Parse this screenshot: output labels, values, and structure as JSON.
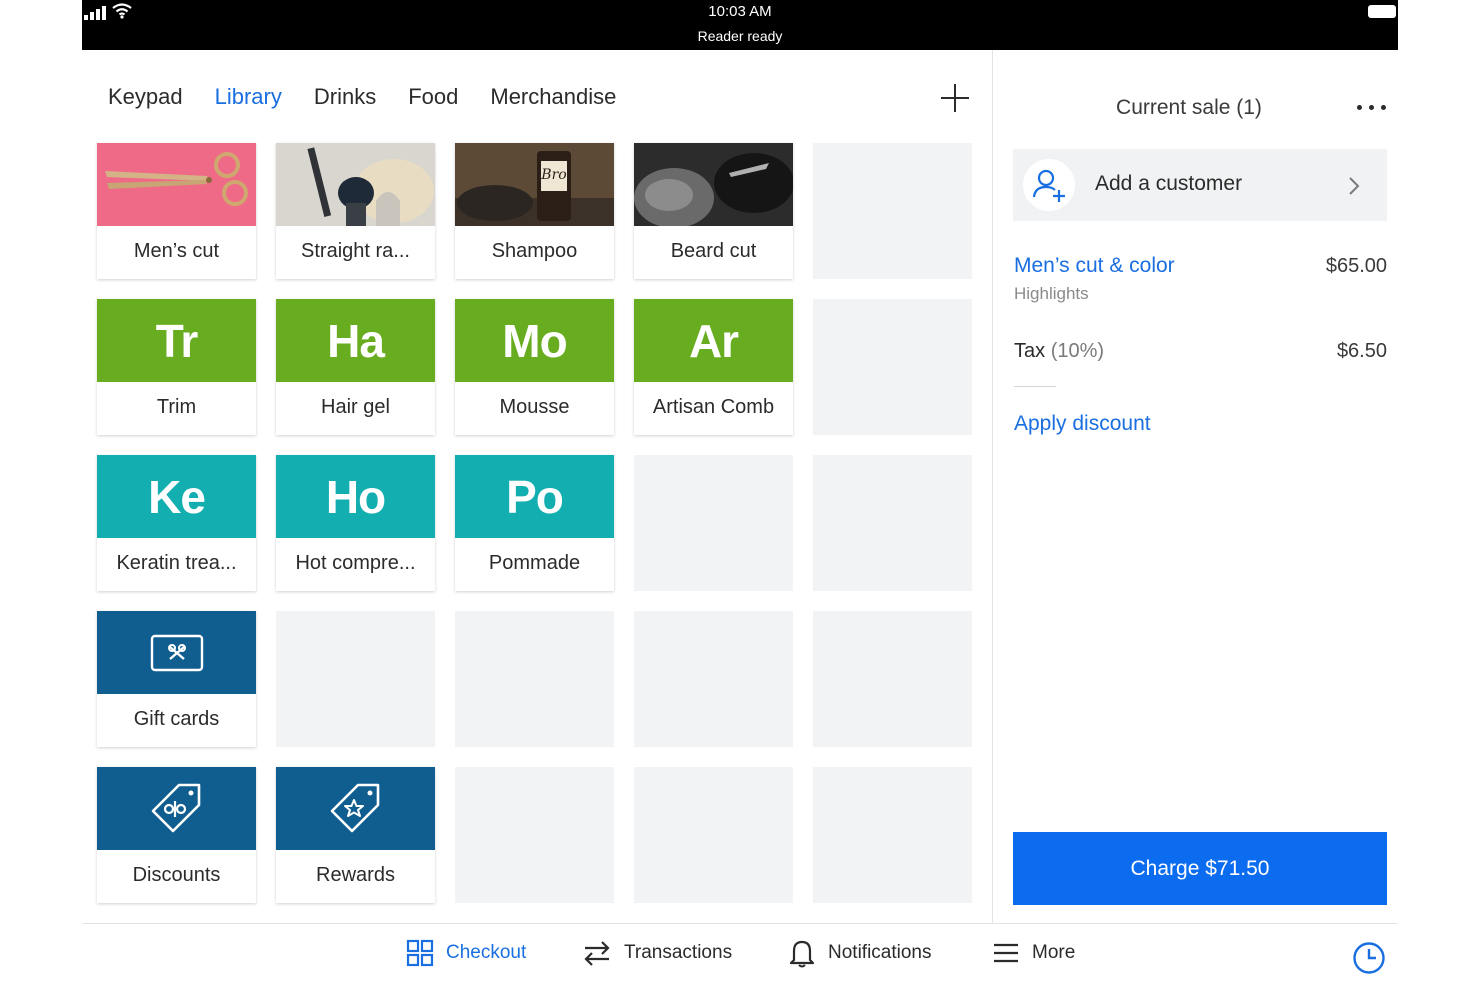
{
  "status_bar": {
    "time": "10:03 AM",
    "reader_status": "Reader ready"
  },
  "tabs": [
    {
      "label": "Keypad",
      "active": false
    },
    {
      "label": "Library",
      "active": true
    },
    {
      "label": "Drinks",
      "active": false
    },
    {
      "label": "Food",
      "active": false
    },
    {
      "label": "Merchandise",
      "active": false
    }
  ],
  "tiles": [
    {
      "label": "Men’s cut",
      "kind": "photo",
      "icon": "scissors-photo",
      "color": "#ef6a86"
    },
    {
      "label": "Straight ra...",
      "kind": "photo",
      "icon": "razor-brush-photo",
      "color": "#d9d6cf"
    },
    {
      "label": "Shampoo",
      "kind": "photo",
      "icon": "shampoo-bottle-photo",
      "color": "#5a4a3a"
    },
    {
      "label": "Beard cut",
      "kind": "photo",
      "icon": "beard-trim-photo",
      "color": "#2a2a2a"
    },
    {
      "label": "Trim",
      "abbr": "Tr",
      "kind": "abbr",
      "color": "#67ad1f"
    },
    {
      "label": "Hair gel",
      "abbr": "Ha",
      "kind": "abbr",
      "color": "#67ad1f"
    },
    {
      "label": "Mousse",
      "abbr": "Mo",
      "kind": "abbr",
      "color": "#67ad1f"
    },
    {
      "label": "Artisan Comb",
      "abbr": "Ar",
      "kind": "abbr",
      "color": "#67ad1f"
    },
    {
      "label": "Keratin trea...",
      "abbr": "Ke",
      "kind": "abbr",
      "color": "#13aeb0"
    },
    {
      "label": "Hot compre...",
      "abbr": "Ho",
      "kind": "abbr",
      "color": "#13aeb0"
    },
    {
      "label": "Pommade",
      "abbr": "Po",
      "kind": "abbr",
      "color": "#13aeb0"
    },
    {
      "label": "Gift cards",
      "kind": "icon",
      "icon": "gift-card-icon",
      "color": "#105d8f"
    },
    {
      "label": "Discounts",
      "kind": "icon",
      "icon": "discount-tag-icon",
      "color": "#105d8f"
    },
    {
      "label": "Rewards",
      "kind": "icon",
      "icon": "reward-tag-icon",
      "color": "#105d8f"
    }
  ],
  "sale": {
    "title": "Current sale (1)",
    "add_customer_label": "Add a customer",
    "line_items": [
      {
        "name": "Men’s cut & color",
        "price": "$65.00",
        "note": "Highlights"
      }
    ],
    "tax_label": "Tax",
    "tax_rate": "(10%)",
    "tax_amount": "$6.50",
    "apply_discount": "Apply discount",
    "charge_label": "Charge $71.50"
  },
  "nav": [
    {
      "label": "Checkout",
      "icon": "grid-icon",
      "active": true
    },
    {
      "label": "Transactions",
      "icon": "swap-arrows-icon",
      "active": false
    },
    {
      "label": "Notifications",
      "icon": "bell-icon",
      "active": false
    },
    {
      "label": "More",
      "icon": "menu-icon",
      "active": false
    }
  ],
  "colors": {
    "accent": "#1a6fe0",
    "charge": "#0b6cf0",
    "green": "#67ad1f",
    "teal": "#13aeb0",
    "navy": "#105d8f"
  }
}
